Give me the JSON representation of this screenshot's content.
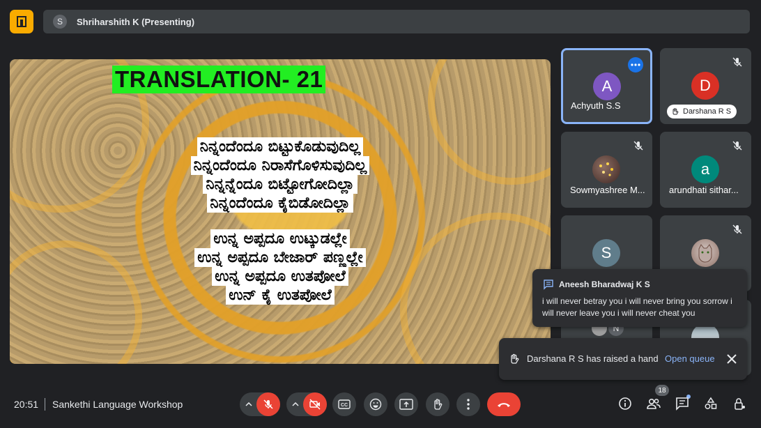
{
  "header": {
    "presenter_initial": "S",
    "presenter_label": "Shriharshith K (Presenting)"
  },
  "slide": {
    "title": "TRANSLATION- 21",
    "kannada_lines": [
      "ನಿನ್ನಂದೆಂದೂ ಬಿಟ್ಟುಕೊಡುವುದಿಲ್ಲ",
      "ನಿನ್ನಂದೆಂದೂ ನಿರಾಸೆಗೊಳಿಸುವುದಿಲ್ಲ",
      "ನಿನ್ನನ್ನೆಂದೂ ಬಿಟ್ಟೋಗೋದಿಲ್ಲಾ",
      "ನಿನ್ನಂದೆಂದೂ ಕೈಬಿಡೋದಿಲ್ಲಾ"
    ],
    "sankethi_lines": [
      "ಉನ್ನ ಅಪ್ಪದೂ ಉಟ್ಕುಡಲ್ಲೇ",
      "ಉನ್ನ ಅಪ್ಪದೂ ಬೇಜಾರ್ ಪಣ್ಣಲ್ಲೇ",
      "ಉನ್ನ ಅಪ್ಪದೂ ಉತಪೋಲೆ",
      "ಉನ್ ಕೈ ಉತಪೋಲೆ"
    ]
  },
  "participants": [
    {
      "initial": "A",
      "name": "Achyuth S.S",
      "color": "#7e57c2"
    },
    {
      "initial": "D",
      "name": "Darshana R S",
      "color": "#d93025",
      "chip": "Darshana R S"
    },
    {
      "initial": "",
      "name": "Sowmyashree M...",
      "color": "#5d4037"
    },
    {
      "initial": "a",
      "name": "arundhati sithar...",
      "color": "#00897b"
    },
    {
      "initial": "S",
      "name": "",
      "color": "#607d8b"
    },
    {
      "initial": "",
      "name": "",
      "color": "#b0a090"
    },
    {
      "initial": "N",
      "name": "",
      "color": "#5f6368"
    }
  ],
  "message": {
    "sender": "Aneesh Bharadwaj K S",
    "text": "i will never betray you i will never bring you sorrow i will never leave you i will never cheat you"
  },
  "hand_toast": {
    "text": "Darshana R S has raised a hand",
    "link": "Open queue"
  },
  "footer": {
    "time": "20:51",
    "meeting_name": "Sankethi Language Workshop",
    "people_count": "18"
  },
  "colors": {
    "accent": "#8ab4f8",
    "danger": "#ea4335",
    "logo": "#f9ab00",
    "highlight": "#22ee22"
  }
}
